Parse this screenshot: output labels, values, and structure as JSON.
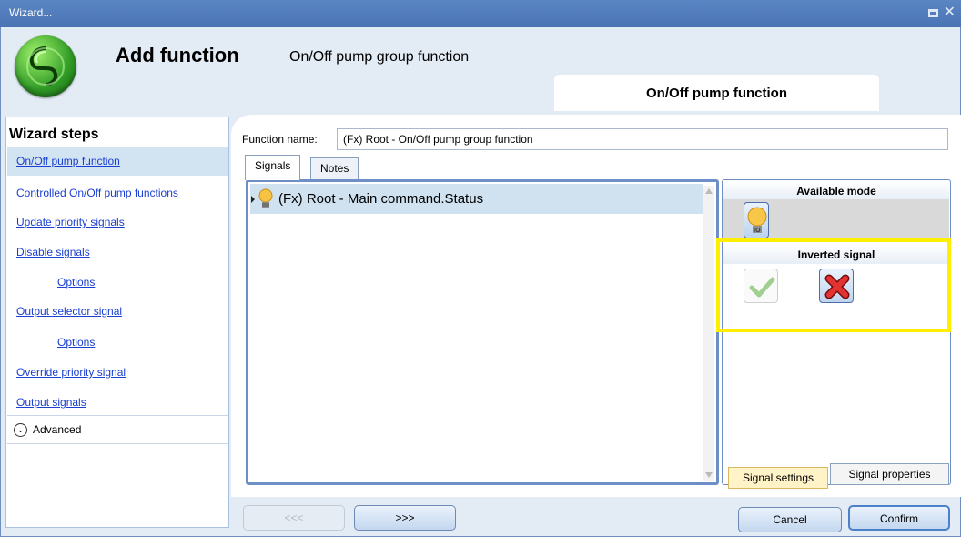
{
  "window": {
    "title": "Wizard..."
  },
  "header": {
    "title": "Add function",
    "subtitle": "On/Off pump group function",
    "current_step": "On/Off pump function"
  },
  "sidebar": {
    "heading": "Wizard steps",
    "items": [
      {
        "label": "On/Off pump function",
        "active": true
      },
      {
        "label": "Controlled On/Off pump functions"
      },
      {
        "label": "Update priority signals"
      },
      {
        "label": "Disable signals"
      },
      {
        "label": "Options",
        "indent": true
      },
      {
        "label": "Output selector signal"
      },
      {
        "label": "Options",
        "indent": true
      },
      {
        "label": "Override priority signal"
      },
      {
        "label": "Output signals"
      }
    ],
    "advanced_label": "Advanced"
  },
  "form": {
    "function_name_label": "Function name:",
    "function_name_value": "(Fx) Root - On/Off pump group function"
  },
  "tabs": [
    {
      "label": "Signals",
      "selected": true
    },
    {
      "label": "Notes"
    }
  ],
  "signals": [
    {
      "label": "(Fx) Root - Main command.Status",
      "icon": "bulb-icon"
    }
  ],
  "right_panel": {
    "available_mode_header": "Available mode",
    "inverted_signal_header": "Inverted signal",
    "inverted_selected": "no",
    "bottom_tabs": [
      "Signal settings",
      "Signal properties"
    ]
  },
  "buttons": {
    "prev": "<<<",
    "next": ">>>",
    "cancel": "Cancel",
    "confirm": "Confirm"
  },
  "colors": {
    "titlebar": "#4a74b4",
    "highlight": "#ffee00",
    "link": "#1a3fd1",
    "selection": "#d0e2f0"
  }
}
